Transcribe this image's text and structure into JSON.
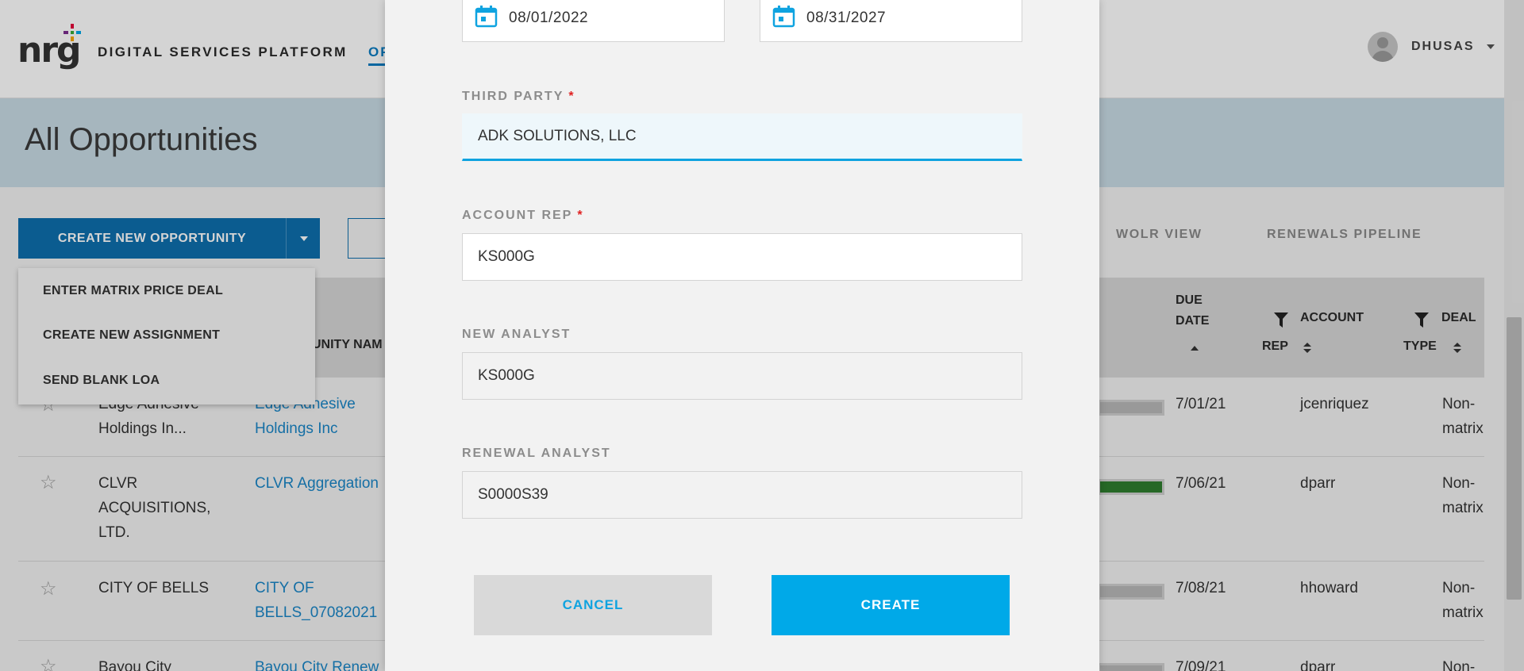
{
  "app": {
    "logo_text": "nrg",
    "platform_title": "DIGITAL SERVICES PLATFORM",
    "nav_tab": "OP",
    "username": "DHUSAS",
    "page_title": "All Opportunities"
  },
  "toolbar": {
    "create_label": "CREATE NEW OPPORTUNITY",
    "views": [
      "WOLR VIEW",
      "RENEWALS PIPELINE"
    ]
  },
  "create_menu": {
    "items": [
      "ENTER MATRIX PRICE DEAL",
      "CREATE NEW ASSIGNMENT",
      "SEND BLANK LOA"
    ]
  },
  "grid": {
    "headers": {
      "opp_name": "UNITY NAM",
      "due_date_1": "DUE",
      "due_date_2": "DATE",
      "account_rep_1": "ACCOUNT",
      "account_rep_2": "REP",
      "deal_type_1": "DEAL",
      "deal_type_2": "TYPE"
    },
    "rows": [
      {
        "customer_1": "Edge Adhesive",
        "customer_2": "Holdings In...",
        "customer_3": "",
        "opp_1": "Edge Adhesive",
        "opp_2": "Holdings Inc",
        "progress": 0.0,
        "due": "7/01/21",
        "rep": "jcenriquez",
        "type_1": "Non-",
        "type_2": "matrix"
      },
      {
        "customer_1": "CLVR",
        "customer_2": "ACQUISITIONS,",
        "customer_3": "LTD.",
        "opp_1": "CLVR Aggregation",
        "opp_2": "",
        "progress": 1.0,
        "due": "7/06/21",
        "rep": "dparr",
        "type_1": "Non-",
        "type_2": "matrix"
      },
      {
        "customer_1": "CITY OF BELLS",
        "customer_2": "",
        "customer_3": "",
        "opp_1": "CITY OF",
        "opp_2": "BELLS_07082021",
        "progress": 0.0,
        "due": "7/08/21",
        "rep": "hhoward",
        "type_1": "Non-",
        "type_2": "matrix"
      },
      {
        "customer_1": "Bayou City",
        "customer_2": "",
        "customer_3": "",
        "opp_1": "Bayou City Renew",
        "opp_2": "",
        "progress": 0.0,
        "due": "7/09/21",
        "rep": "dparr",
        "type_1": "Non-",
        "type_2": ""
      }
    ]
  },
  "modal": {
    "start_date": "08/01/2022",
    "end_date": "08/31/2027",
    "third_party_label": "THIRD PARTY",
    "third_party_value": "ADK SOLUTIONS, LLC",
    "account_rep_label": "ACCOUNT REP",
    "account_rep_value": "KS000G",
    "new_analyst_label": "NEW ANALYST",
    "new_analyst_value": "KS000G",
    "renewal_analyst_label": "RENEWAL ANALYST",
    "renewal_analyst_value": "S0000S39",
    "required_marker": "*",
    "cancel_label": "CANCEL",
    "create_label": "CREATE"
  },
  "colors": {
    "primary_blue": "#00a9e8",
    "nav_blue": "#0e6fae",
    "link_blue": "#1a86c7",
    "required_red": "#e02020",
    "progress_green": "#2e7d2e"
  }
}
